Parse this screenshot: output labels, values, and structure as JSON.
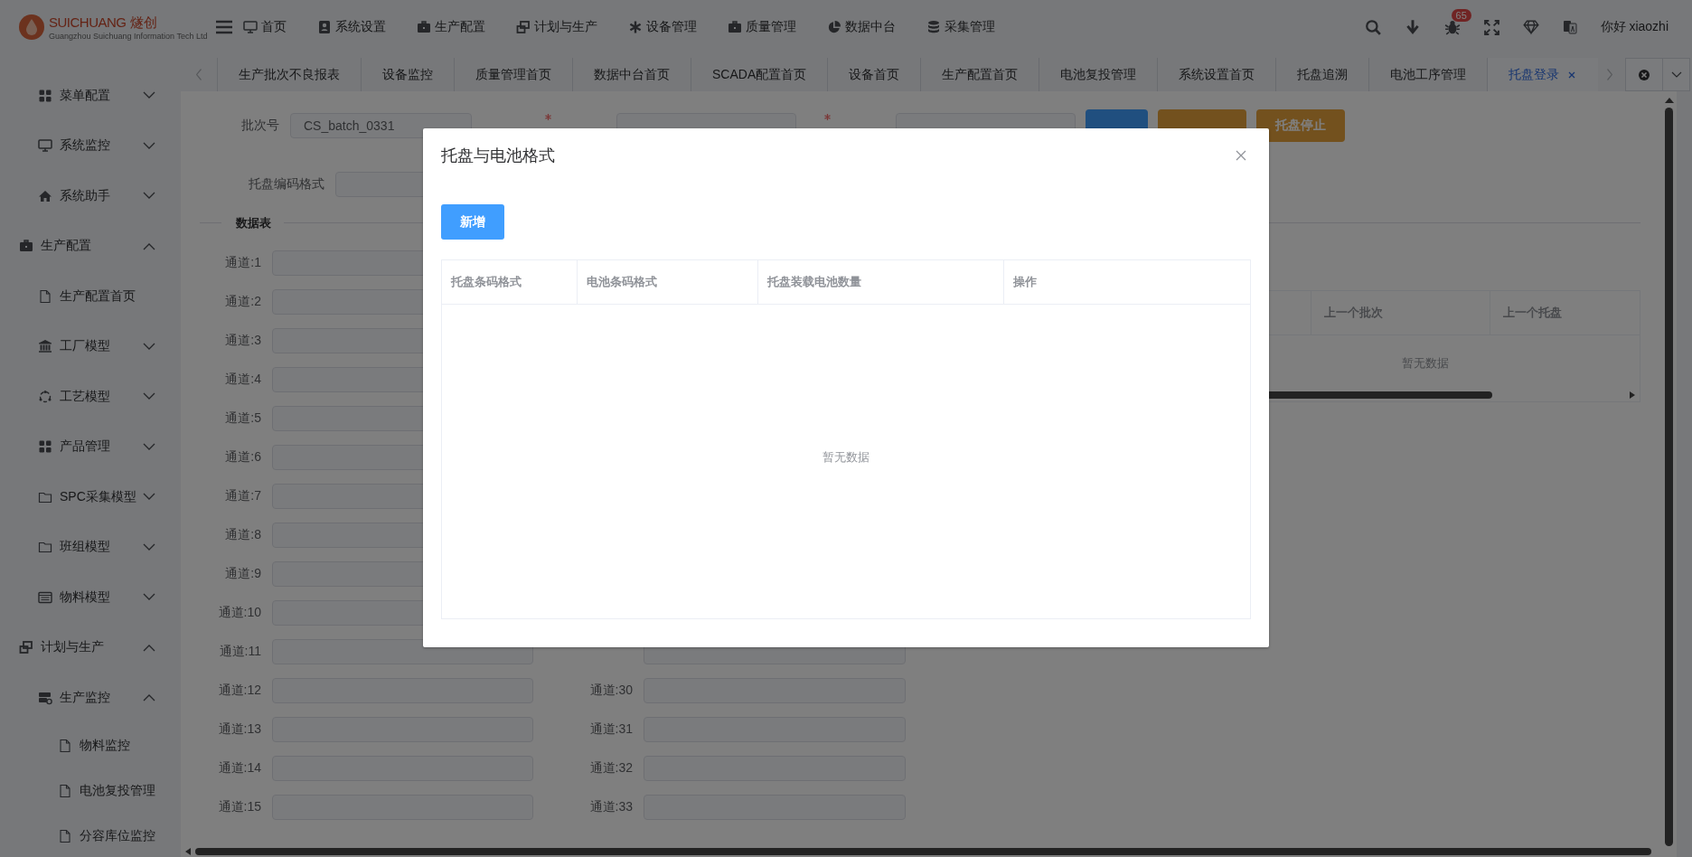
{
  "header": {
    "logo": {
      "name": "SUICHUANG",
      "name_cn": "燧创",
      "subtitle": "Guangzhou Suichuang Information Tech Ltd"
    },
    "nav": [
      "首页",
      "系统设置",
      "生产配置",
      "计划与生产",
      "设备管理",
      "质量管理",
      "数据中台",
      "采集管理"
    ],
    "badge": "65",
    "greeting": "你好 xiaozhi"
  },
  "sidebar": {
    "continued_items": [
      {
        "label": "菜单配置",
        "expanded": false
      },
      {
        "label": "系统监控",
        "expanded": false
      },
      {
        "label": "系统助手",
        "expanded": false
      }
    ],
    "items": [
      {
        "label": "生产配置",
        "expanded": true,
        "children": [
          {
            "label": "生产配置首页"
          },
          {
            "label": "工厂模型",
            "expanded": false
          },
          {
            "label": "工艺模型",
            "expanded": false
          },
          {
            "label": "产品管理",
            "expanded": false
          },
          {
            "label": "SPC采集模型",
            "expanded": false
          },
          {
            "label": "班组模型",
            "expanded": false
          },
          {
            "label": "物料模型",
            "expanded": false
          }
        ]
      },
      {
        "label": "计划与生产",
        "expanded": true,
        "children": [
          {
            "label": "生产监控",
            "expanded": true,
            "children": [
              {
                "label": "物料监控"
              },
              {
                "label": "电池复投管理"
              },
              {
                "label": "分容库位监控"
              }
            ]
          }
        ]
      }
    ]
  },
  "tabs": [
    {
      "label": "生产批次不良报表",
      "selected": false
    },
    {
      "label": "设备监控",
      "selected": false
    },
    {
      "label": "质量管理首页",
      "selected": false
    },
    {
      "label": "数据中台首页",
      "selected": false
    },
    {
      "label": "SCADA配置首页",
      "selected": false
    },
    {
      "label": "设备首页",
      "selected": false
    },
    {
      "label": "生产配置首页",
      "selected": false
    },
    {
      "label": "电池复投管理",
      "selected": false
    },
    {
      "label": "系统设置首页",
      "selected": false
    },
    {
      "label": "托盘追溯",
      "selected": false
    },
    {
      "label": "电池工序管理",
      "selected": false
    },
    {
      "label": "托盘登录",
      "selected": true
    }
  ],
  "form": {
    "batch": {
      "label": "批次号",
      "value": "CS_batch_0331"
    },
    "tray_code": {
      "required": true
    },
    "battery_code": {
      "required": true
    },
    "buttons": [
      {
        "kind": "primary"
      },
      {
        "kind": "warning"
      },
      {
        "kind": "warning",
        "label": "托盘停止"
      }
    ],
    "tray_format": {
      "label": "托盘编码格式"
    }
  },
  "section_title": "数据表",
  "channels_left": [
    "通道:1",
    "通道:2",
    "通道:3",
    "通道:4",
    "通道:5",
    "通道:6",
    "通道:7",
    "通道:8",
    "通道:9",
    "通道:10",
    "通道:11",
    "通道:12",
    "通道:13",
    "通道:14",
    "通道:15"
  ],
  "channels_right": [
    "通道:30",
    "通道:31",
    "通道:32",
    "通道:33"
  ],
  "log_table": {
    "columns": [
      "上一个批次",
      "上一个托盘"
    ],
    "empty_text": "暂无数据"
  },
  "dialog": {
    "title": "托盘与电池格式",
    "add_button": "新增",
    "columns": [
      "托盘条码格式",
      "电池条码格式",
      "托盘装载电池数量",
      "操作"
    ],
    "empty_text": "暂无数据"
  }
}
